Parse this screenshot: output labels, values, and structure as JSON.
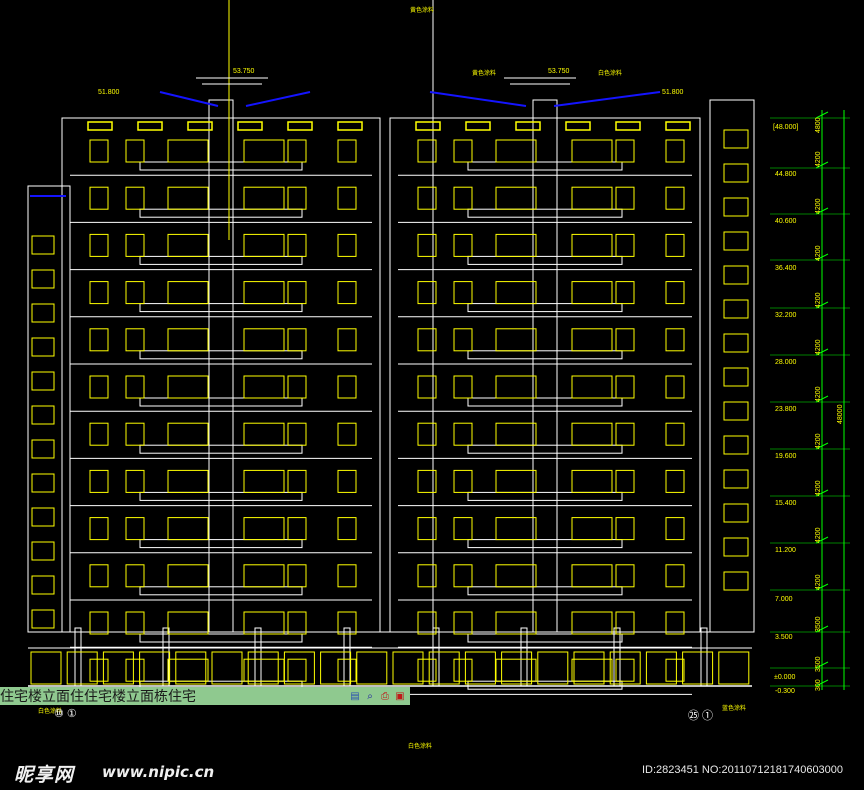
{
  "drawing": {
    "line_color": "#ffffff",
    "window_color": "#ffff00",
    "roof_color": "#1414ff",
    "dimension_color": "#00ff00",
    "background": "#000000",
    "floors_per_block": 14
  },
  "elevations": {
    "roof_top_center": "53.750",
    "roof_top_right": "53.750",
    "roof_left": "51.800",
    "roof_right": "51.800",
    "scale_marks": [
      "[48.000]",
      "44.800",
      "40.600",
      "36.400",
      "32.200",
      "28.000",
      "23.800",
      "19.600",
      "15.400",
      "11.200",
      "7.000",
      "3.500",
      "±0.000",
      "-0.300"
    ]
  },
  "dimensions": {
    "segments": [
      "4800",
      "4200",
      "4200",
      "4200",
      "4200",
      "4200",
      "4200",
      "4200",
      "4200",
      "4200",
      "4200",
      "3500",
      "3500",
      "300"
    ],
    "total": "48000"
  },
  "notes": {
    "top_center": "黄色涂料",
    "top_right_a": "黄色涂料",
    "top_right_b": "白色涂料",
    "bottom_left": "白色涂料",
    "bottom_center": "白色涂料",
    "bottom_right": "蓝色涂料"
  },
  "axes": {
    "left_label": "⑩ ①",
    "right_label": "㉕ ①"
  },
  "title_bar": {
    "text": "住宅楼立面住住宅楼立面栋住宅",
    "icons": [
      "toolbar-icon-a",
      "zoom-icon",
      "print-icon",
      "save-icon"
    ]
  },
  "watermark": {
    "logo": "昵享网",
    "url": "www.nipic.cn",
    "id": "ID:2823451 NO:20110712181740603000"
  }
}
